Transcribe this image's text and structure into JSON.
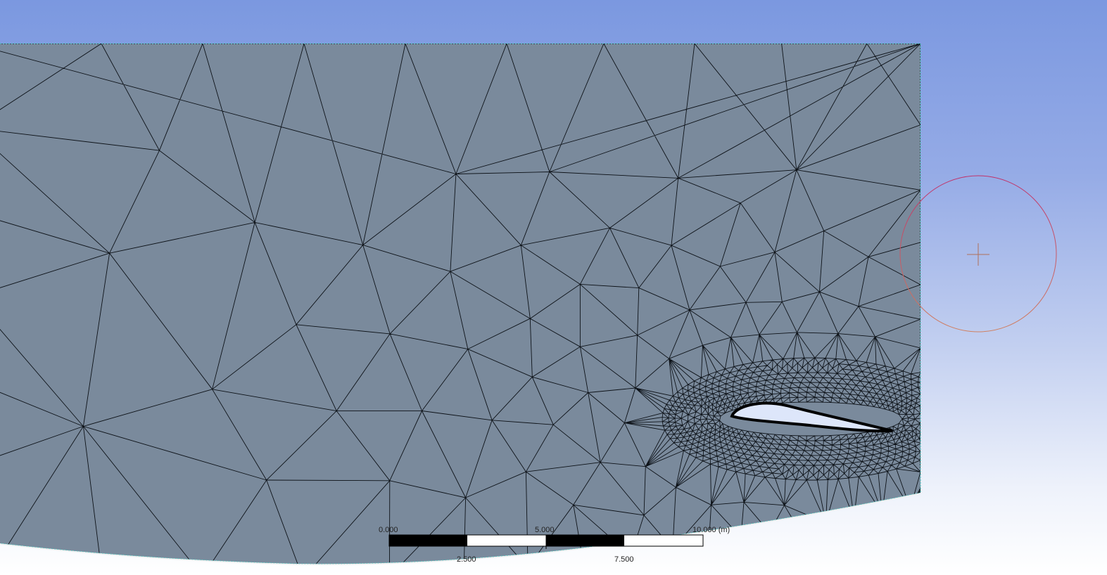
{
  "viewport": {
    "background_top": "#7b98e0",
    "background_bottom": "#ffffff"
  },
  "mesh": {
    "fill_color": "#7a8a9c",
    "edge_color": "#0d1218",
    "airfoil_color": "#dde6fa"
  },
  "scale_bar": {
    "tick_0": "0.000",
    "tick_2_5": "2.500",
    "tick_5": "5.000",
    "tick_7_5": "7.500",
    "tick_10": "10.000 (m)"
  },
  "triad": {
    "icon": "rotation-center-circle-icon",
    "circle_color": "#c0306a",
    "cross_color": "#b0705a"
  }
}
